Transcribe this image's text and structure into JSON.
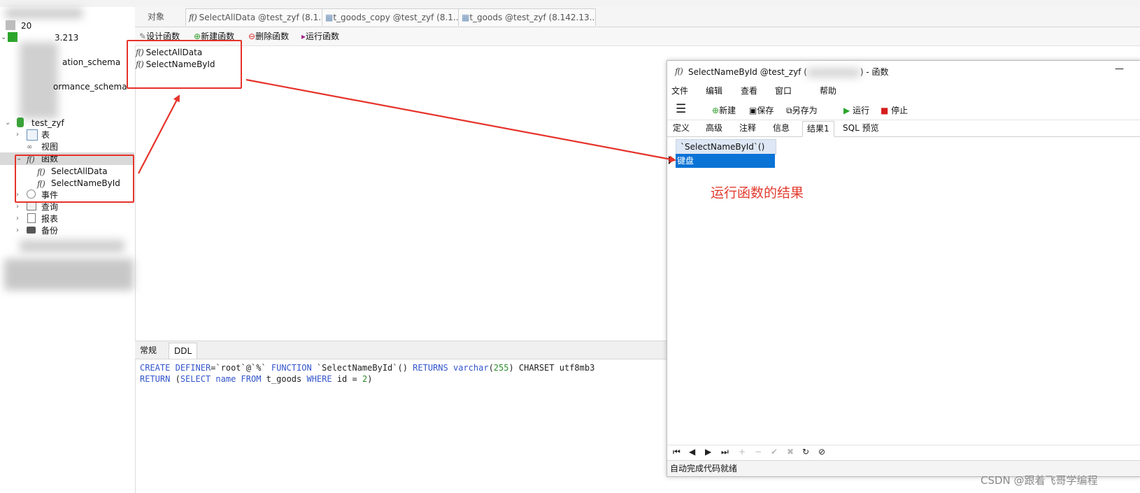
{
  "left_tree": {
    "items": [
      {
        "label": "20",
        "name": "tree-conn-1"
      },
      {
        "label": "3.213",
        "name": "tree-conn-2"
      },
      {
        "label": "ation_schema",
        "name": "tree-db-information-schema"
      },
      {
        "label": "ormance_schema",
        "name": "tree-db-performance-schema"
      },
      {
        "label": "test_zyf",
        "name": "tree-db-test-zyf"
      },
      {
        "label": "表",
        "name": "tree-tables"
      },
      {
        "label": "视图",
        "name": "tree-views"
      },
      {
        "label": "函数",
        "name": "tree-functions"
      },
      {
        "label": "SelectAllData",
        "name": "tree-fn-selectalldata"
      },
      {
        "label": "SelectNameById",
        "name": "tree-fn-selectnamebyid"
      },
      {
        "label": "事件",
        "name": "tree-events"
      },
      {
        "label": "查询",
        "name": "tree-queries"
      },
      {
        "label": "报表",
        "name": "tree-reports"
      },
      {
        "label": "备份",
        "name": "tree-backups"
      }
    ]
  },
  "tabs": [
    {
      "label": "对象"
    },
    {
      "label": "SelectAllData @test_zyf (8.1..."
    },
    {
      "label": "t_goods_copy @test_zyf (8.1..."
    },
    {
      "label": "t_goods @test_zyf (8.142.13..."
    }
  ],
  "toolbar": {
    "design": "设计函数",
    "new": "新建函数",
    "delete": "删除函数",
    "run": "运行函数"
  },
  "function_list": [
    "SelectAllData",
    "SelectNameById"
  ],
  "bottom_tabs": [
    "常规",
    "DDL"
  ],
  "ddl": {
    "line1": {
      "t1": "CREATE",
      "t2": "DEFINER",
      "t3": "=`root`@`%` ",
      "t4": "FUNCTION",
      "t5": " `SelectNameById`() ",
      "t6": "RETURNS",
      "t7": " ",
      "t8": "varchar",
      "t9": "(",
      "t10": "255",
      "t11": ") CHARSET utf8mb3"
    },
    "line2": {
      "t1": "RETURN",
      "t2": " (",
      "t3": "SELECT",
      "t4": " ",
      "t5": "name",
      "t6": " ",
      "t7": "FROM",
      "t8": " t_goods ",
      "t9": "WHERE",
      "t10": " id = ",
      "t11": "2",
      "t12": ")"
    }
  },
  "func_window": {
    "title_main": "SelectNameById @test_zyf (",
    "title_suffix": ") - 函数",
    "minimize": "—",
    "menu": [
      "文件",
      "编辑",
      "查看",
      "窗口",
      "帮助"
    ],
    "tools": {
      "new": "新建",
      "save": "保存",
      "save_as": "另存为",
      "run": "运行",
      "stop": "停止"
    },
    "tabs": [
      "定义",
      "高级",
      "注释",
      "信息",
      "结果1",
      "SQL 预览"
    ],
    "result_header": "`SelectNameById`()",
    "result_value": "键盘",
    "annotation": "运行函数的结果",
    "status": "自动完成代码就绪"
  },
  "watermark": "CSDN @跟着飞哥学编程",
  "colors": {
    "accent": "#e5332a",
    "selection": "#0a73d6"
  }
}
